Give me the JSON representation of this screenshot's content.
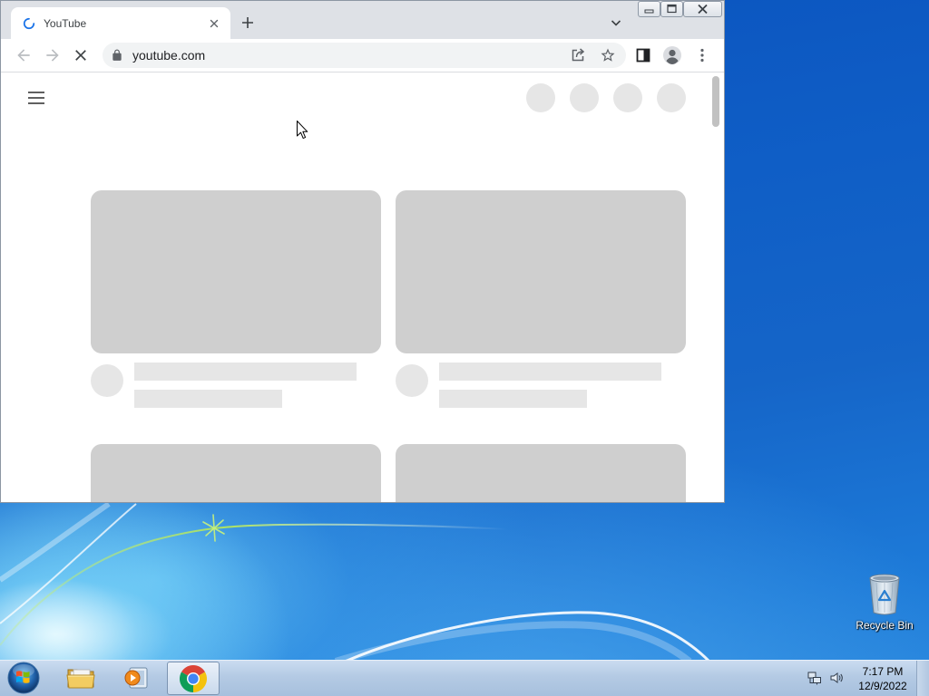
{
  "browser": {
    "window_controls": {
      "minimize_icon": "minimize-icon",
      "maximize_icon": "maximize-icon",
      "close_icon": "close-icon"
    },
    "tab": {
      "title": "YouTube",
      "favicon": "loading-spinner-icon",
      "close_icon": "close-tab-icon"
    },
    "new_tab_icon": "plus-icon",
    "tab_search_icon": "chevron-down-icon",
    "toolbar": {
      "back_icon": "arrow-back-icon",
      "forward_icon": "arrow-forward-icon",
      "stop_icon": "stop-loading-icon",
      "side_panel_icon": "side-panel-icon",
      "profile_icon": "profile-avatar-icon",
      "menu_icon": "more-vert-icon"
    },
    "omnibox": {
      "security_icon": "lock-icon",
      "url": "youtube.com",
      "share_icon": "share-icon",
      "bookmark_icon": "star-outline-icon"
    }
  },
  "desktop": {
    "icons": [
      {
        "label": "Recycle Bin",
        "icon": "recycle-bin-icon"
      }
    ]
  },
  "taskbar": {
    "start_icon": "windows-start-orb-icon",
    "apps": [
      {
        "icon": "windows-explorer-icon",
        "active": false
      },
      {
        "icon": "windows-media-player-icon",
        "active": false
      },
      {
        "icon": "chrome-icon",
        "active": true
      }
    ],
    "tray": {
      "network_icon": "network-icon",
      "volume_icon": "volume-icon",
      "time": "7:17 PM",
      "date": "12/9/2022"
    }
  },
  "colors": {
    "skeleton_thumbnail": "#cfcfcf",
    "skeleton_text": "#e6e6e6",
    "loading_spinner": "#1a73e8",
    "desktop_blue": "#1565c8"
  }
}
